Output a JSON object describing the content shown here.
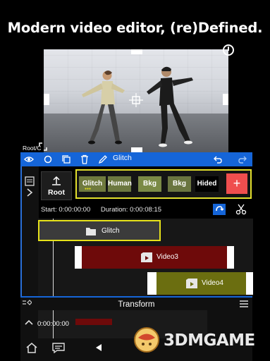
{
  "headline": "Modern video editor, (re)Defined.",
  "toolbar": {
    "crumb": "Glitch",
    "icons": [
      "eye-icon",
      "circle-icon",
      "copy-icon",
      "trash-icon",
      "pen-icon",
      "undo-icon",
      "redo-icon"
    ]
  },
  "preview": {
    "corner_label": "Root/C"
  },
  "layer_bar": {
    "root_label": "Root",
    "layers": [
      {
        "label": "Glitch",
        "dots": "●●●",
        "bg": "#6f7a3e"
      },
      {
        "label": "Human",
        "bg": "#6c7840"
      },
      {
        "label": "Bkg",
        "bg": "#7b8a46"
      },
      {
        "label": "Bkg",
        "bg": "#6a7540"
      },
      {
        "label": "Hided",
        "bg": "#000000"
      }
    ],
    "add_label": "+"
  },
  "timing": {
    "start_label": "Start:",
    "start_value": "0:00:00:00",
    "duration_label": "Duration:",
    "duration_value": "0:00:08:15"
  },
  "timeline": {
    "clips": [
      {
        "label": "Glitch",
        "color": "#3b3b3b",
        "border": "#e6e21a"
      },
      {
        "label": "Video3",
        "color": "#6e0a0a",
        "border": ""
      },
      {
        "label": "Video4",
        "color": "#6b6e10",
        "border": ""
      }
    ]
  },
  "bottom_panel": {
    "title": "Transform",
    "time": "0:00:00:00"
  },
  "watermark": "3DMGAME",
  "colors": {
    "accent": "#1565d8",
    "highlight": "#e6e21a",
    "add": "#ef4e4e"
  }
}
